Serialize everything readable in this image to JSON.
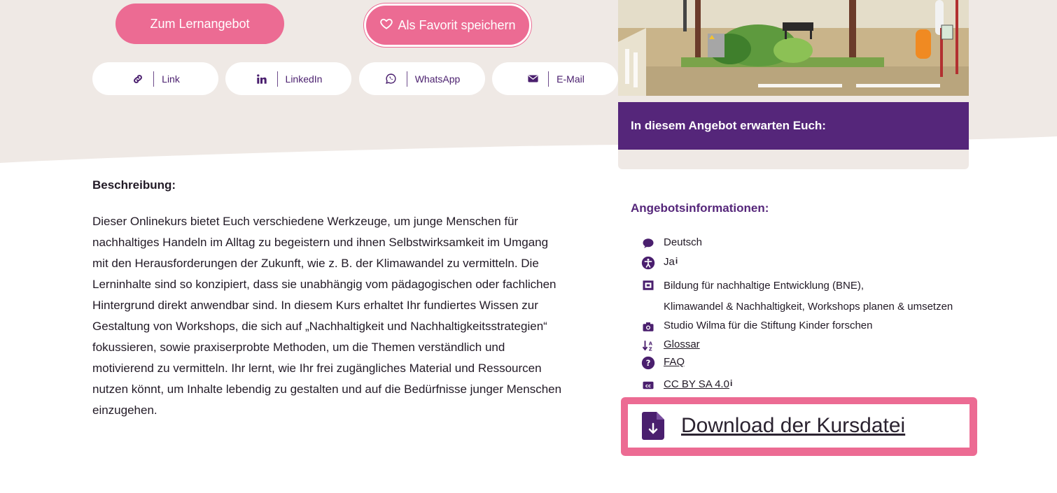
{
  "actions": {
    "primary_label": "Zum Lernangebot",
    "favorite_label": "Als Favorit speichern"
  },
  "share": [
    {
      "label": "Link",
      "icon": "link-icon"
    },
    {
      "label": "LinkedIn",
      "icon": "linkedin-icon"
    },
    {
      "label": "WhatsApp",
      "icon": "whatsapp-icon"
    },
    {
      "label": "E-Mail",
      "icon": "envelope-icon"
    }
  ],
  "expect": {
    "title": "In diesem Angebot erwarten Euch:"
  },
  "description": {
    "heading": "Beschreibung:",
    "text": "Dieser Onlinekurs bietet Euch verschiedene Werkzeuge, um junge Menschen für nachhaltiges Handeln im Alltag zu begeistern und ihnen Selbstwirksamkeit im Umgang mit den Herausforderungen der Zukunft, wie z. B. der Klimawandel zu vermitteln. Die Lerninhalte sind so konzipiert, dass sie unabhängig vom pädagogischen oder fachlichen Hintergrund direkt anwendbar sind. In diesem Kurs erhaltet Ihr fundiertes Wissen zur Gestaltung von Workshops, die sich auf „Nachhaltigkeit und Nachhaltigkeitsstrategien“ fokussieren, sowie praxiserprobte Methoden, um die Themen verständlich und motivierend zu vermitteln. Ihr lernt, wie Ihr frei zugängliches Material und Ressourcen nutzen könnt, um Inhalte lebendig zu gestalten und auf die Bedürfnisse junger Menschen einzugehen."
  },
  "info": {
    "heading": "Angebotsinformationen:",
    "language": "Deutsch",
    "accessibility": "Ja",
    "info_marker": "i",
    "topics_line1": "Bildung für nachhaltige Entwicklung (BNE),",
    "topics_line2": "Klimawandel & Nachhaltigkeit, Workshops planen & umsetzen",
    "credit": "Studio Wilma für die Stiftung Kinder forschen",
    "glossary": "Glossar",
    "faq": "FAQ",
    "license": "CC BY SA 4.0",
    "license_icon_text": "cc"
  },
  "download": {
    "label": "Download der Kursdatei"
  },
  "colors": {
    "pink": "#ec6b93",
    "purple": "#55267a",
    "beige": "#efe9e5"
  }
}
